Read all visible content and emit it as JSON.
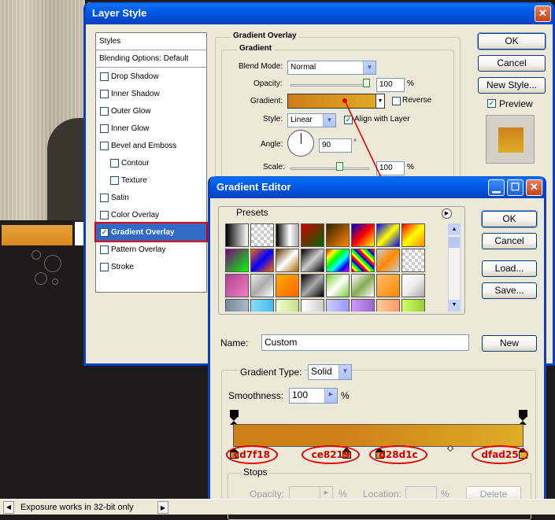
{
  "layer_style": {
    "title": "Layer Style",
    "styles_header": "Styles",
    "blending_options": "Blending Options: Default",
    "items": [
      {
        "label": "Drop Shadow",
        "checked": false
      },
      {
        "label": "Inner Shadow",
        "checked": false
      },
      {
        "label": "Outer Glow",
        "checked": false
      },
      {
        "label": "Inner Glow",
        "checked": false
      },
      {
        "label": "Bevel and Emboss",
        "checked": false
      },
      {
        "label": "Contour",
        "checked": false
      },
      {
        "label": "Texture",
        "checked": false
      },
      {
        "label": "Satin",
        "checked": false
      },
      {
        "label": "Color Overlay",
        "checked": false
      },
      {
        "label": "Gradient Overlay",
        "checked": true
      },
      {
        "label": "Pattern Overlay",
        "checked": false
      },
      {
        "label": "Stroke",
        "checked": false
      }
    ],
    "section_title": "Gradient Overlay",
    "group_title": "Gradient",
    "blend_mode_label": "Blend Mode:",
    "blend_mode_value": "Normal",
    "opacity_label": "Opacity:",
    "opacity_value": "100",
    "opacity_unit": "%",
    "opacity_level": 1.0,
    "gradient_label": "Gradient:",
    "reverse_label": "Reverse",
    "style_label": "Style:",
    "style_value": "Linear",
    "align_label": "Align with Layer",
    "align_checked": true,
    "angle_label": "Angle:",
    "angle_value": "90",
    "angle_unit": "°",
    "scale_label": "Scale:",
    "scale_value": "100",
    "scale_unit": "%",
    "buttons": {
      "ok": "OK",
      "cancel": "Cancel",
      "new_style": "New Style..."
    },
    "preview_label": "Preview",
    "preview_checked": true
  },
  "gradient_editor": {
    "title": "Gradient Editor",
    "presets_label": "Presets",
    "buttons": {
      "ok": "OK",
      "cancel": "Cancel",
      "load": "Load...",
      "save": "Save...",
      "new": "New",
      "delete": "Delete"
    },
    "name_label": "Name:",
    "name_value": "Custom",
    "gradient_type_label": "Gradient Type:",
    "gradient_type_value": "Solid",
    "smoothness_label": "Smoothness:",
    "smoothness_value": "100",
    "smoothness_unit": "%",
    "stops_label": "Stops",
    "stop_opacity_label": "Opacity:",
    "stop_opacity_unit": "%",
    "stop_location_label": "Location:",
    "stop_location_unit": "%",
    "color_stops": [
      "cd7f18",
      "ce8219",
      "d28d1c",
      "dfad25"
    ],
    "colors": {
      "stop1": "#cd7f18",
      "stop2": "#ce8219",
      "stop3": "#d28d1c",
      "stop4": "#dfad25"
    }
  },
  "status_bar": {
    "text": "Exposure works in 32-bit only"
  },
  "icons": {
    "close": "close-icon",
    "minimize": "minimize-icon",
    "maximize": "maximize-icon",
    "menu": "menu-arrow-icon"
  }
}
